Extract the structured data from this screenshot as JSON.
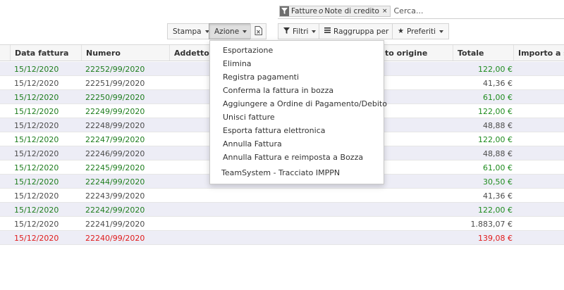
{
  "search": {
    "facet_label_a": "Fatture",
    "facet_or": "o",
    "facet_label_b": "Note di credito",
    "facet_close": "×",
    "placeholder": "Cerca..."
  },
  "toolbar": {
    "stampa_label": "Stampa",
    "azione_label": "Azione",
    "filtri_label": "Filtri",
    "raggruppa_label": "Raggruppa per",
    "preferiti_label": "Preferiti"
  },
  "table": {
    "columns": [
      "Data fattura",
      "Numero",
      "Addetto v",
      "to origine",
      "Totale",
      "Importo a sa"
    ],
    "rows": [
      {
        "date": "15/12/2020",
        "number": "22252/99/2020",
        "total": "122,00 €",
        "style": "green"
      },
      {
        "date": "15/12/2020",
        "number": "22251/99/2020",
        "total": "41,36 €",
        "style": "black"
      },
      {
        "date": "15/12/2020",
        "number": "22250/99/2020",
        "total": "61,00 €",
        "style": "green"
      },
      {
        "date": "15/12/2020",
        "number": "22249/99/2020",
        "total": "122,00 €",
        "style": "green"
      },
      {
        "date": "15/12/2020",
        "number": "22248/99/2020",
        "total": "48,88 €",
        "style": "black"
      },
      {
        "date": "15/12/2020",
        "number": "22247/99/2020",
        "total": "122,00 €",
        "style": "green"
      },
      {
        "date": "15/12/2020",
        "number": "22246/99/2020",
        "total": "48,88 €",
        "style": "black"
      },
      {
        "date": "15/12/2020",
        "number": "22245/99/2020",
        "total": "61,00 €",
        "style": "green"
      },
      {
        "date": "15/12/2020",
        "number": "22244/99/2020",
        "total": "30,50 €",
        "style": "green"
      },
      {
        "date": "15/12/2020",
        "number": "22243/99/2020",
        "total": "41,36 €",
        "style": "black"
      },
      {
        "date": "15/12/2020",
        "number": "22242/99/2020",
        "total": "122,00 €",
        "style": "green"
      },
      {
        "date": "15/12/2020",
        "number": "22241/99/2020",
        "total": "1.883,07 €",
        "style": "black"
      },
      {
        "date": "15/12/2020",
        "number": "22240/99/2020",
        "total": "139,08 €",
        "style": "red"
      }
    ]
  },
  "dropdown": {
    "items": [
      "Esportazione",
      "Elimina",
      "Registra pagamenti",
      "Conferma la fattura in bozza",
      "Aggiungere a Ordine di Pagamento/Debito",
      "Unisci fatture",
      "Esporta fattura elettronica",
      "Annulla Fattura",
      "Annulla Fattura e reimposta a Bozza",
      "TeamSystem - Tracciato IMPPN"
    ]
  },
  "colors": {
    "green_text": "#1f7e1f",
    "red_text": "#e01b1b",
    "alt_row": "#ededf6",
    "filter_icon_bg": "#6d6d6d"
  },
  "icons": [
    "filter-icon",
    "close-icon",
    "excel-export-icon",
    "filter-funnel-icon",
    "group-by-icon",
    "star-icon",
    "caret-down-icon"
  ]
}
